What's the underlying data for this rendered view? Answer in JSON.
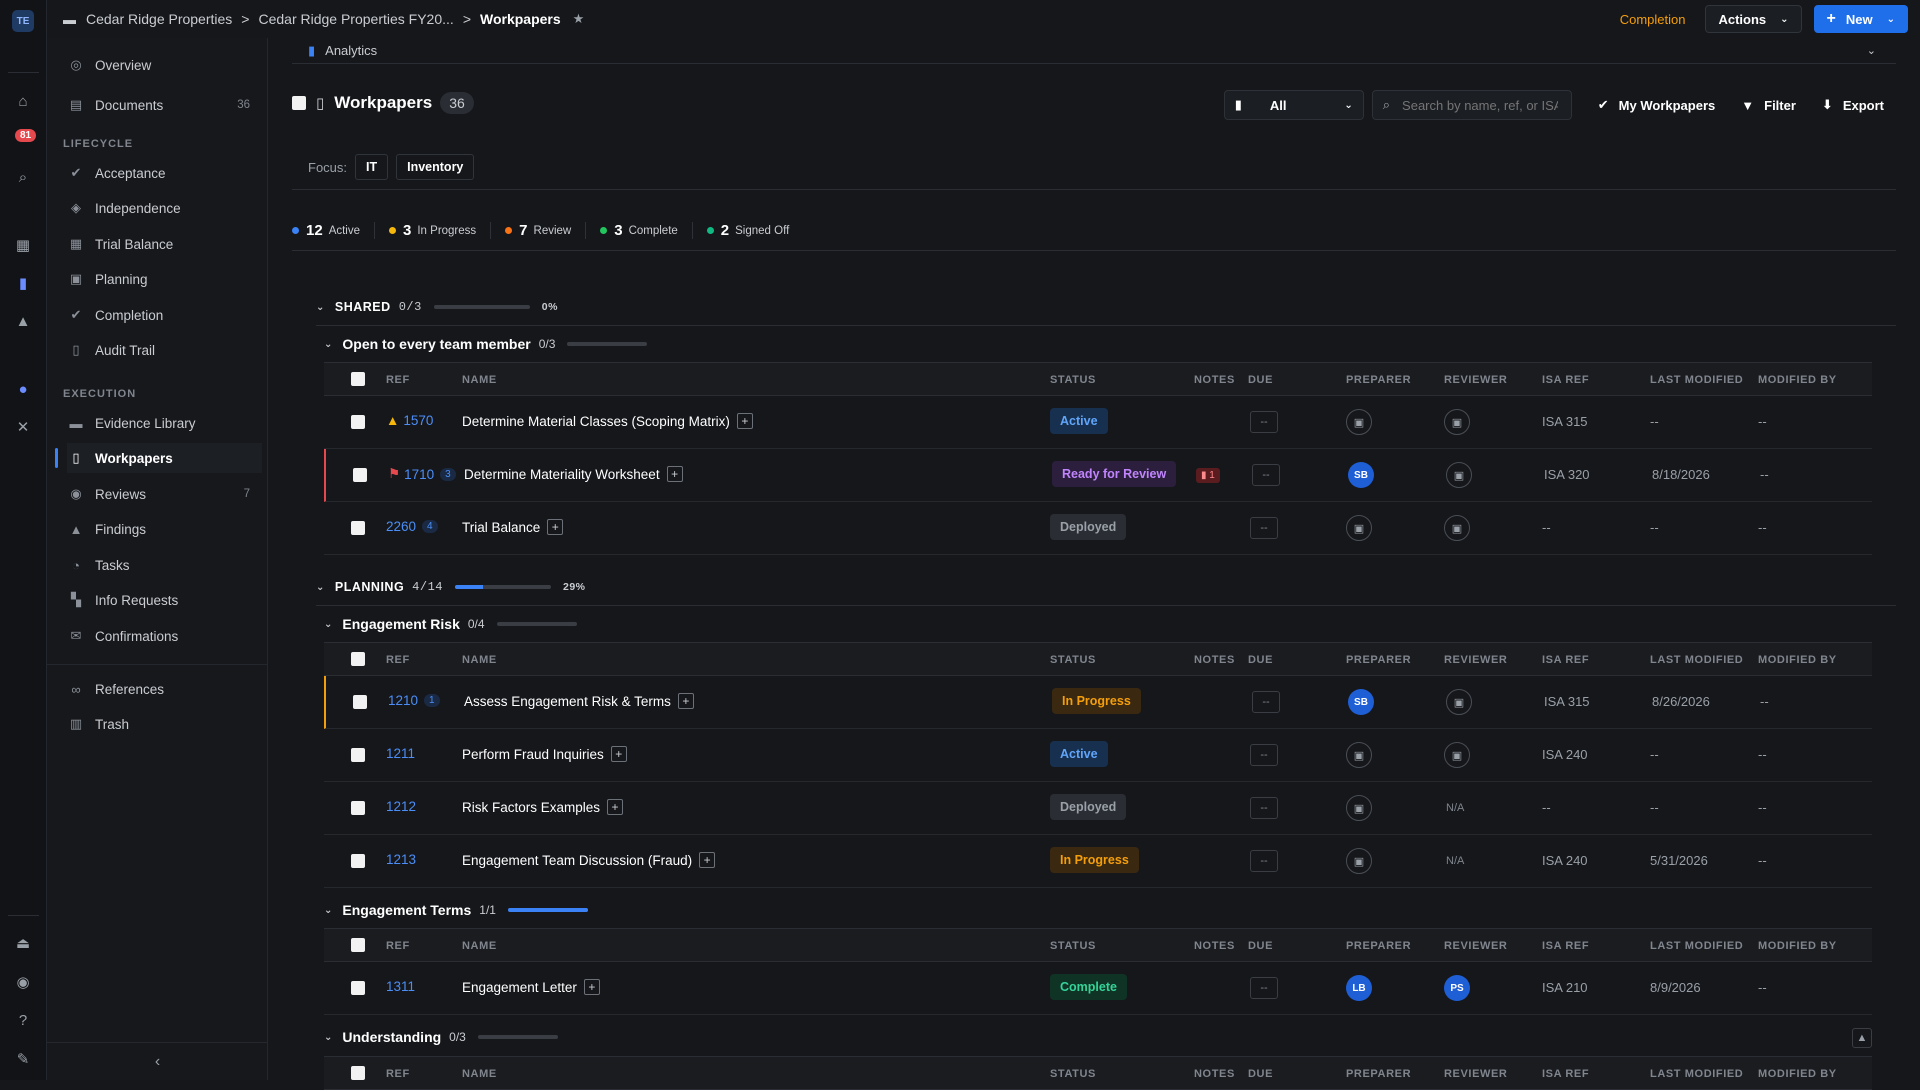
{
  "rail": {
    "avatar": "TE",
    "badge": "81"
  },
  "breadcrumb": [
    "Cedar Ridge Properties",
    "Cedar Ridge Properties FY20...",
    "Workpapers"
  ],
  "top": {
    "completion": "Completion",
    "actions": "Actions",
    "new": "New"
  },
  "sidebar": {
    "top_items": [
      {
        "label": "Overview",
        "icon": "overview-icon"
      },
      {
        "label": "Documents",
        "icon": "documents-icon",
        "count": "36"
      }
    ],
    "lifecycle_label": "LIFECYCLE",
    "lifecycle": [
      "Acceptance",
      "Independence",
      "Trial Balance",
      "Planning",
      "Completion",
      "Audit Trail"
    ],
    "execution_label": "EXECUTION",
    "execution": [
      {
        "label": "Evidence Library"
      },
      {
        "label": "Workpapers",
        "active": true
      },
      {
        "label": "Reviews",
        "count": "7"
      },
      {
        "label": "Findings"
      },
      {
        "label": "Tasks"
      },
      {
        "label": "Info Requests"
      },
      {
        "label": "Confirmations"
      }
    ],
    "bottom": [
      "References",
      "Trash"
    ]
  },
  "analytics_label": "Analytics",
  "workpapers": {
    "title": "Workpapers",
    "count": "36"
  },
  "filter": {
    "selected": "All",
    "search_placeholder": "Search by name, ref, or ISA",
    "my": "My Workpapers",
    "filter": "Filter",
    "export": "Export"
  },
  "focus": {
    "label": "Focus:",
    "chips": [
      "IT",
      "Inventory"
    ]
  },
  "stats": [
    {
      "n": "12",
      "label": "Active",
      "color": "#3b82f6"
    },
    {
      "n": "3",
      "label": "In Progress",
      "color": "#f5b70b"
    },
    {
      "n": "7",
      "label": "Review",
      "color": "#f97316"
    },
    {
      "n": "3",
      "label": "Complete",
      "color": "#22c55e"
    },
    {
      "n": "2",
      "label": "Signed Off",
      "color": "#10b981"
    }
  ],
  "columns": [
    "REF",
    "NAME",
    "STATUS",
    "NOTES",
    "DUE",
    "PREPARER",
    "REVIEWER",
    "ISA REF",
    "LAST MODIFIED",
    "MODIFIED BY"
  ],
  "groups": {
    "shared": {
      "name": "SHARED",
      "frac": "0/3",
      "pct": "0%",
      "progress": 0
    },
    "planning": {
      "name": "PLANNING",
      "frac": "4/14",
      "pct": "29%",
      "progress": 0.29
    }
  },
  "subgroups": {
    "open": {
      "name": "Open to every team member",
      "frac": "0/3",
      "progress": 0
    },
    "risk": {
      "name": "Engagement Risk",
      "frac": "0/4",
      "progress": 0
    },
    "terms": {
      "name": "Engagement Terms",
      "frac": "1/1",
      "progress": 1
    },
    "understanding": {
      "name": "Understanding",
      "frac": "0/3",
      "progress": 0
    }
  },
  "rows": [
    {
      "ref": "1570",
      "name": "Determine Material Classes (Scoping Matrix)",
      "status": "Active",
      "due": "--",
      "isa": "ISA 315",
      "modified": "--",
      "by": "--"
    },
    {
      "ref": "1710",
      "ref_count": "3",
      "name": "Determine Materiality Worksheet",
      "status": "Ready for Review",
      "notes": "1",
      "due": "--",
      "preparer": "SB",
      "isa": "ISA 320",
      "modified": "8/18/2026",
      "by": "--"
    },
    {
      "ref": "2260",
      "ref_count": "4",
      "name": "Trial Balance",
      "status": "Deployed",
      "due": "--",
      "isa": "--",
      "modified": "--",
      "by": "--"
    },
    {
      "ref": "1210",
      "ref_count": "1",
      "name": "Assess Engagement Risk & Terms",
      "status": "In Progress",
      "due": "--",
      "preparer": "SB",
      "isa": "ISA 315",
      "modified": "8/26/2026",
      "by": "--"
    },
    {
      "ref": "1211",
      "name": "Perform Fraud Inquiries",
      "status": "Active",
      "due": "--",
      "isa": "ISA 240",
      "modified": "--",
      "by": "--"
    },
    {
      "ref": "1212",
      "name": "Risk Factors Examples",
      "status": "Deployed",
      "due": "--",
      "reviewer": "N/A",
      "isa": "--",
      "modified": "--",
      "by": "--"
    },
    {
      "ref": "1213",
      "name": "Engagement Team Discussion (Fraud)",
      "status": "In Progress",
      "due": "--",
      "reviewer": "N/A",
      "isa": "ISA 240",
      "modified": "5/31/2026",
      "by": "--"
    },
    {
      "ref": "1311",
      "name": "Engagement Letter",
      "status": "Complete",
      "due": "--",
      "preparer": "LB",
      "reviewer": "PS",
      "isa": "ISA 210",
      "modified": "8/9/2026",
      "by": "--"
    }
  ]
}
